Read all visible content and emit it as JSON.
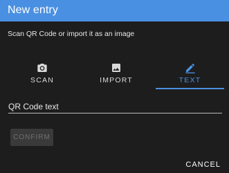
{
  "dialog": {
    "title": "New entry",
    "subtitle": "Scan QR Code or import it as an image"
  },
  "tabs": [
    {
      "label": "SCAN",
      "icon": "camera-icon",
      "active": false
    },
    {
      "label": "IMPORT",
      "icon": "image-icon",
      "active": false
    },
    {
      "label": "TEXT",
      "icon": "pencil-icon",
      "active": true
    }
  ],
  "text_field": {
    "value": "QR Code text"
  },
  "buttons": {
    "confirm_label": "CONFIRM",
    "cancel_label": "CANCEL"
  },
  "colors": {
    "accent": "#4a90e2",
    "background": "#1d1d1d",
    "disabled_button_bg": "#3a3a3a",
    "disabled_button_text": "#707070"
  }
}
